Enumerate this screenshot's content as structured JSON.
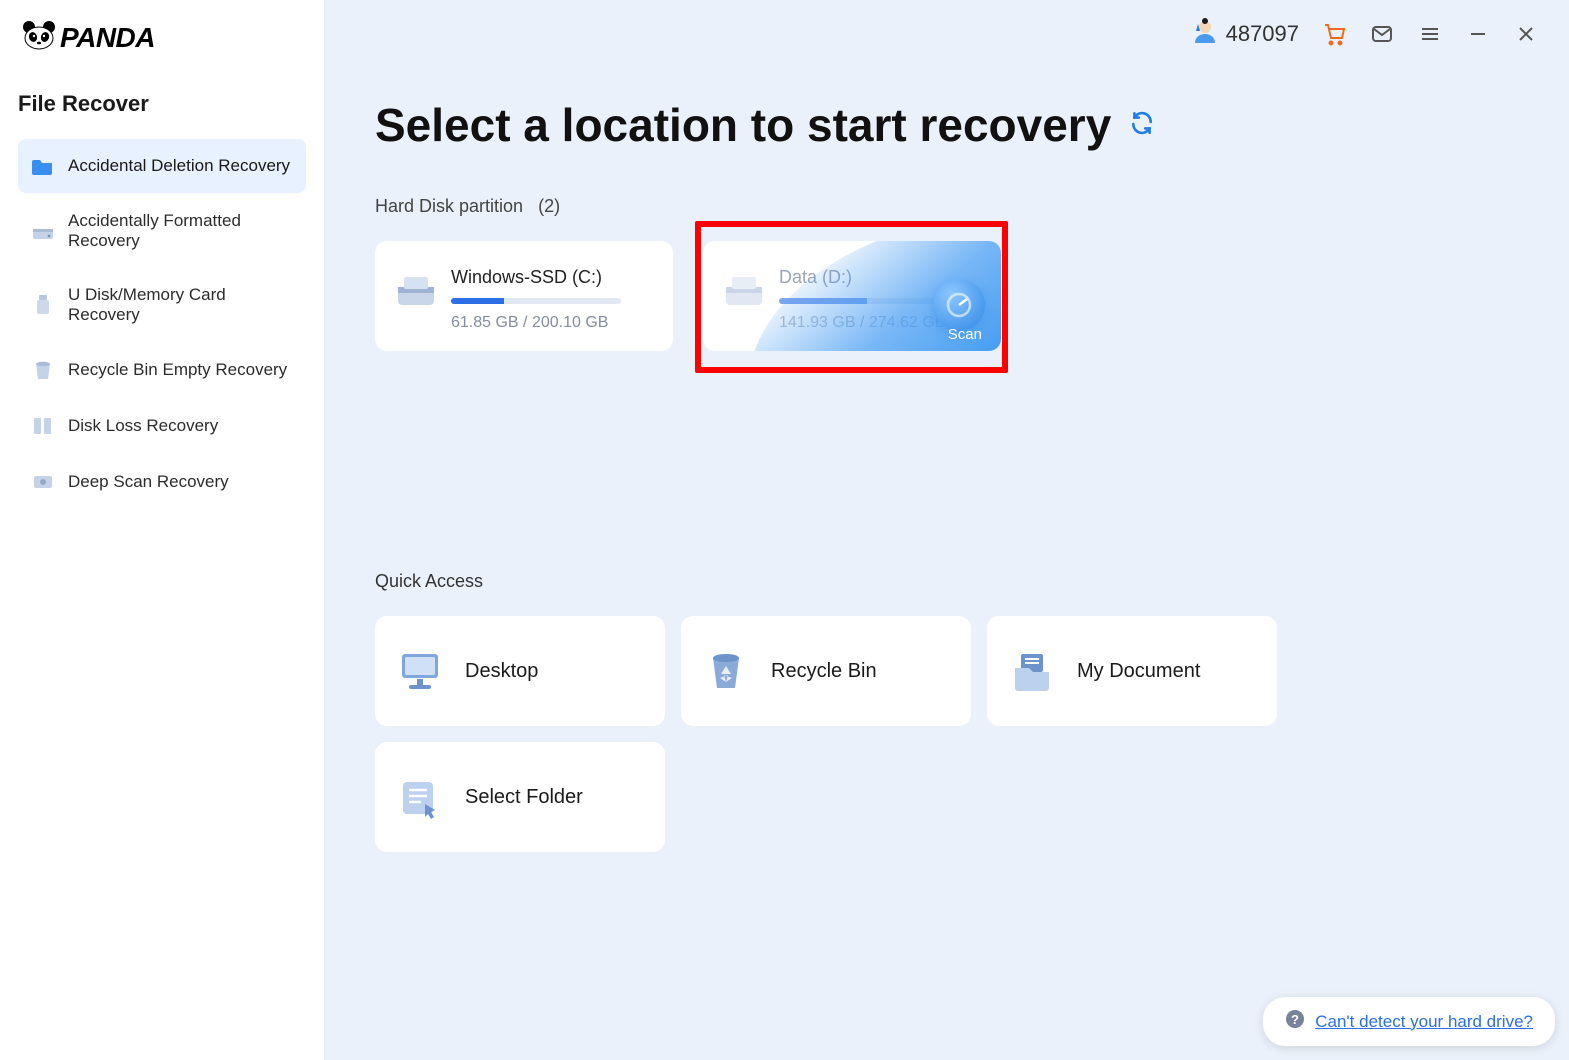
{
  "brand": "PANDA",
  "sidebar": {
    "section_title": "File Recover",
    "items": [
      {
        "label": "Accidental Deletion Recovery",
        "icon": "folder-icon"
      },
      {
        "label": "Accidentally Formatted Recovery",
        "icon": "drive-icon"
      },
      {
        "label": "U Disk/Memory Card Recovery",
        "icon": "usb-icon"
      },
      {
        "label": "Recycle Bin Empty Recovery",
        "icon": "bin-icon"
      },
      {
        "label": "Disk Loss Recovery",
        "icon": "book-icon"
      },
      {
        "label": "Deep Scan Recovery",
        "icon": "scanner-icon"
      }
    ]
  },
  "topbar": {
    "user_id": "487097"
  },
  "page": {
    "title": "Select a location to start recovery",
    "partitions_header_prefix": "Hard Disk partition",
    "partitions_count": "(2)",
    "partitions": [
      {
        "name": "Windows-SSD   (C:)",
        "used_label": "61.85 GB / 200.10 GB",
        "fill_pct": 31
      },
      {
        "name": "Data   (D:)",
        "used_label": "141.93 GB / 274.62 GB",
        "fill_pct": 52,
        "scan_label": "Scan"
      }
    ],
    "quick_title": "Quick Access",
    "quick": [
      {
        "label": "Desktop",
        "icon": "desktop-icon"
      },
      {
        "label": "Recycle Bin",
        "icon": "recycle-bin-icon"
      },
      {
        "label": "My Document",
        "icon": "document-folder-icon"
      },
      {
        "label": "Select Folder",
        "icon": "select-folder-icon"
      }
    ],
    "help_link": "Can't detect your hard drive?"
  }
}
